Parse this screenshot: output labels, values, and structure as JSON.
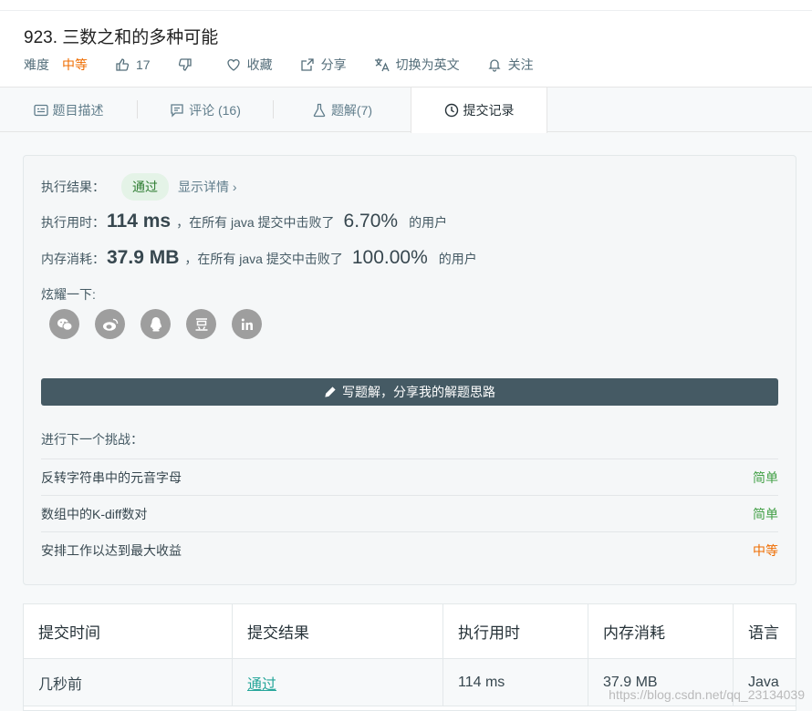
{
  "problem": {
    "title": "923. 三数之和的多种可能",
    "difficulty_label": "难度",
    "difficulty_value": "中等",
    "likes": "17",
    "favorite_label": "收藏",
    "share_label": "分享",
    "switch_lang_label": "切换为英文",
    "follow_label": "关注"
  },
  "tabs": [
    {
      "label": "题目描述"
    },
    {
      "label": "评论 (16)"
    },
    {
      "label": "题解(7)"
    },
    {
      "label": "提交记录"
    }
  ],
  "result": {
    "label": "执行结果：",
    "status": "通过",
    "detail_link": "显示详情 ›",
    "time_label": "执行用时：",
    "time_value": "114 ms",
    "time_mid": "，在所有 java 提交中击败了",
    "time_pct": "6.70%",
    "time_suffix": "的用户",
    "mem_label": "内存消耗：",
    "mem_value": "37.9 MB",
    "mem_mid": "，在所有 java 提交中击败了",
    "mem_pct": "100.00%",
    "mem_suffix": "的用户",
    "share_label": "炫耀一下:",
    "share_icons": [
      "wechat-icon",
      "weibo-icon",
      "qq-icon",
      "douban-icon",
      "linkedin-icon"
    ],
    "write_button": "写题解，分享我的解题思路"
  },
  "next": {
    "title": "进行下一个挑战：",
    "items": [
      {
        "name": "反转字符串中的元音字母",
        "level": "简单"
      },
      {
        "name": "数组中的K-diff数对",
        "level": "简单"
      },
      {
        "name": "安排工作以达到最大收益",
        "level": "中等"
      }
    ]
  },
  "submissions": {
    "headers": [
      "提交时间",
      "提交结果",
      "执行用时",
      "内存消耗",
      "语言"
    ],
    "rows": [
      {
        "time": "几秒前",
        "result": "通过",
        "runtime": "114 ms",
        "memory": "37.9 MB",
        "lang": "Java"
      }
    ]
  },
  "colors": {
    "accent_medium": "#ef6c00",
    "accent_easy": "#43a047",
    "pass_green": "#2e7d32",
    "button_dark": "#455a64"
  },
  "watermark": "https://blog.csdn.net/qq_23134039"
}
